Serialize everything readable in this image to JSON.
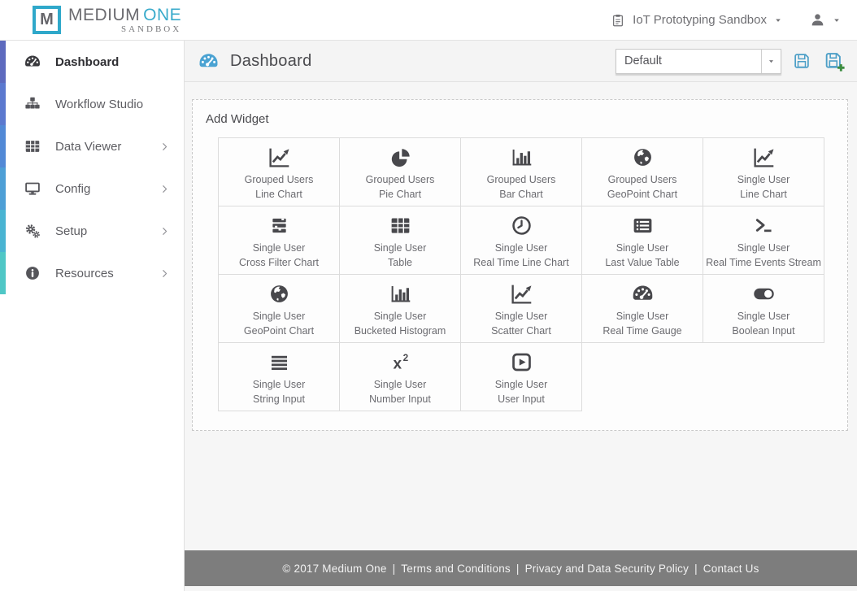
{
  "topbar": {
    "logo": {
      "mark": "M",
      "name_primary": "MEDIUM",
      "name_secondary": "ONE",
      "subtitle": "SANDBOX"
    },
    "sandbox": {
      "label": "IoT Prototyping Sandbox"
    }
  },
  "sidebar": {
    "items": [
      {
        "label": "Dashboard",
        "icon": "gauge",
        "chevron": false,
        "active": true,
        "accent": "#5d6abe"
      },
      {
        "label": "Workflow Studio",
        "icon": "sitemap",
        "chevron": false,
        "active": false,
        "accent": "#5b79cf"
      },
      {
        "label": "Data Viewer",
        "icon": "table",
        "chevron": true,
        "active": false,
        "accent": "#5289d6"
      },
      {
        "label": "Config",
        "icon": "desktop",
        "chevron": true,
        "active": false,
        "accent": "#4d9fd6"
      },
      {
        "label": "Setup",
        "icon": "gears",
        "chevron": true,
        "active": false,
        "accent": "#49b4d2"
      },
      {
        "label": "Resources",
        "icon": "info",
        "chevron": true,
        "active": false,
        "accent": "#4fc7c6"
      }
    ]
  },
  "header": {
    "title": "Dashboard",
    "select_value": "Default"
  },
  "add_widget": {
    "title": "Add Widget",
    "widgets": [
      {
        "group": "Grouped Users",
        "type": "Line Chart",
        "icon": "line-chart"
      },
      {
        "group": "Grouped Users",
        "type": "Pie Chart",
        "icon": "pie-chart"
      },
      {
        "group": "Grouped Users",
        "type": "Bar Chart",
        "icon": "bar-chart"
      },
      {
        "group": "Grouped Users",
        "type": "GeoPoint Chart",
        "icon": "globe"
      },
      {
        "group": "Single User",
        "type": "Line Chart",
        "icon": "line-chart"
      },
      {
        "group": "Single User",
        "type": "Cross Filter Chart",
        "icon": "cross-filter"
      },
      {
        "group": "Single User",
        "type": "Table",
        "icon": "table"
      },
      {
        "group": "Single User",
        "type": "Real Time Line Chart",
        "icon": "clock"
      },
      {
        "group": "Single User",
        "type": "Last Value Table",
        "icon": "list"
      },
      {
        "group": "Single User",
        "type": "Real Time Events Stream",
        "icon": "terminal"
      },
      {
        "group": "Single User",
        "type": "GeoPoint Chart",
        "icon": "globe"
      },
      {
        "group": "Single User",
        "type": "Bucketed Histogram",
        "icon": "bar-chart"
      },
      {
        "group": "Single User",
        "type": "Scatter Chart",
        "icon": "line-chart"
      },
      {
        "group": "Single User",
        "type": "Real Time Gauge",
        "icon": "gauge"
      },
      {
        "group": "Single User",
        "type": "Boolean Input",
        "icon": "toggle"
      },
      {
        "group": "Single User",
        "type": "String Input",
        "icon": "align-justify"
      },
      {
        "group": "Single User",
        "type": "Number Input",
        "icon": "superscript"
      },
      {
        "group": "Single User",
        "type": "User Input",
        "icon": "play-square"
      }
    ]
  },
  "footer": {
    "copyright": "© 2017 Medium One",
    "separator": "|",
    "links": [
      "Terms and Conditions",
      "Privacy and Data Security Policy",
      "Contact Us"
    ]
  },
  "colors": {
    "brand_teal": "#2fa8ca",
    "header_icon_blue": "#4aa2d2",
    "save_icon_blue": "#4d9fc7",
    "plus_green": "#3c8c40",
    "footer_bg": "#7d7d7d",
    "sidebar_gradient_top": "#5d6abe",
    "sidebar_gradient_bottom": "#4fc7c6"
  }
}
